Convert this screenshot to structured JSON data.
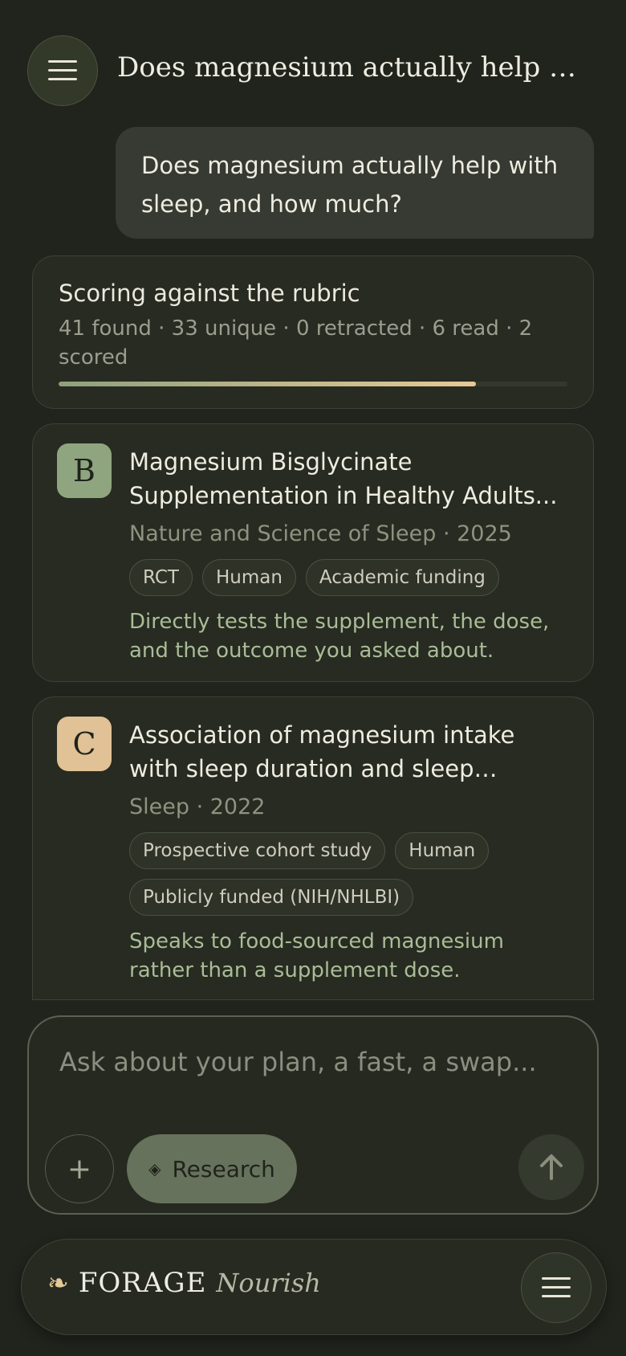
{
  "header": {
    "title": "Does magnesium actually help with ...",
    "menu_icon": "hamburger-icon"
  },
  "conversation": {
    "user_message": "Does magnesium actually help with sleep, and how much?"
  },
  "status": {
    "title": "Scoring against the rubric",
    "meta": "41 found · 33 unique · 0 retracted · 6 read · 2 scored",
    "progress": 0.82,
    "colors": {
      "start": "#8ea07e",
      "end": "#e8c996"
    }
  },
  "studies": [
    {
      "grade": "B",
      "grade_color": "#8fa57f",
      "title": "Magnesium Bisglycinate Supplementation in Healthy Adults...",
      "meta": "Nature and Science of Sleep · 2025",
      "tags": [
        "RCT",
        "Human",
        "Academic funding"
      ],
      "note": "Directly tests the supplement, the dose, and the outcome you asked about."
    },
    {
      "grade": "C",
      "grade_color": "#e1c296",
      "title": "Association of magnesium intake with sleep duration and sleep quality:...",
      "meta": "Sleep · 2022",
      "tags": [
        "Prospective cohort study",
        "Human",
        "Publicly funded (NIH/NHLBI)"
      ],
      "note": "Speaks to food-sourced magnesium rather than a supplement dose."
    }
  ],
  "composer": {
    "placeholder": "Ask about your plan, a fast, a swap...",
    "plus_label": "+",
    "research_label": "Research",
    "research_icon": "◈",
    "send_icon": "arrow-up-icon"
  },
  "bottom_bar": {
    "brand_icon": "❧",
    "brand_name": "FORAGE",
    "brand_sub": "Nourish"
  }
}
